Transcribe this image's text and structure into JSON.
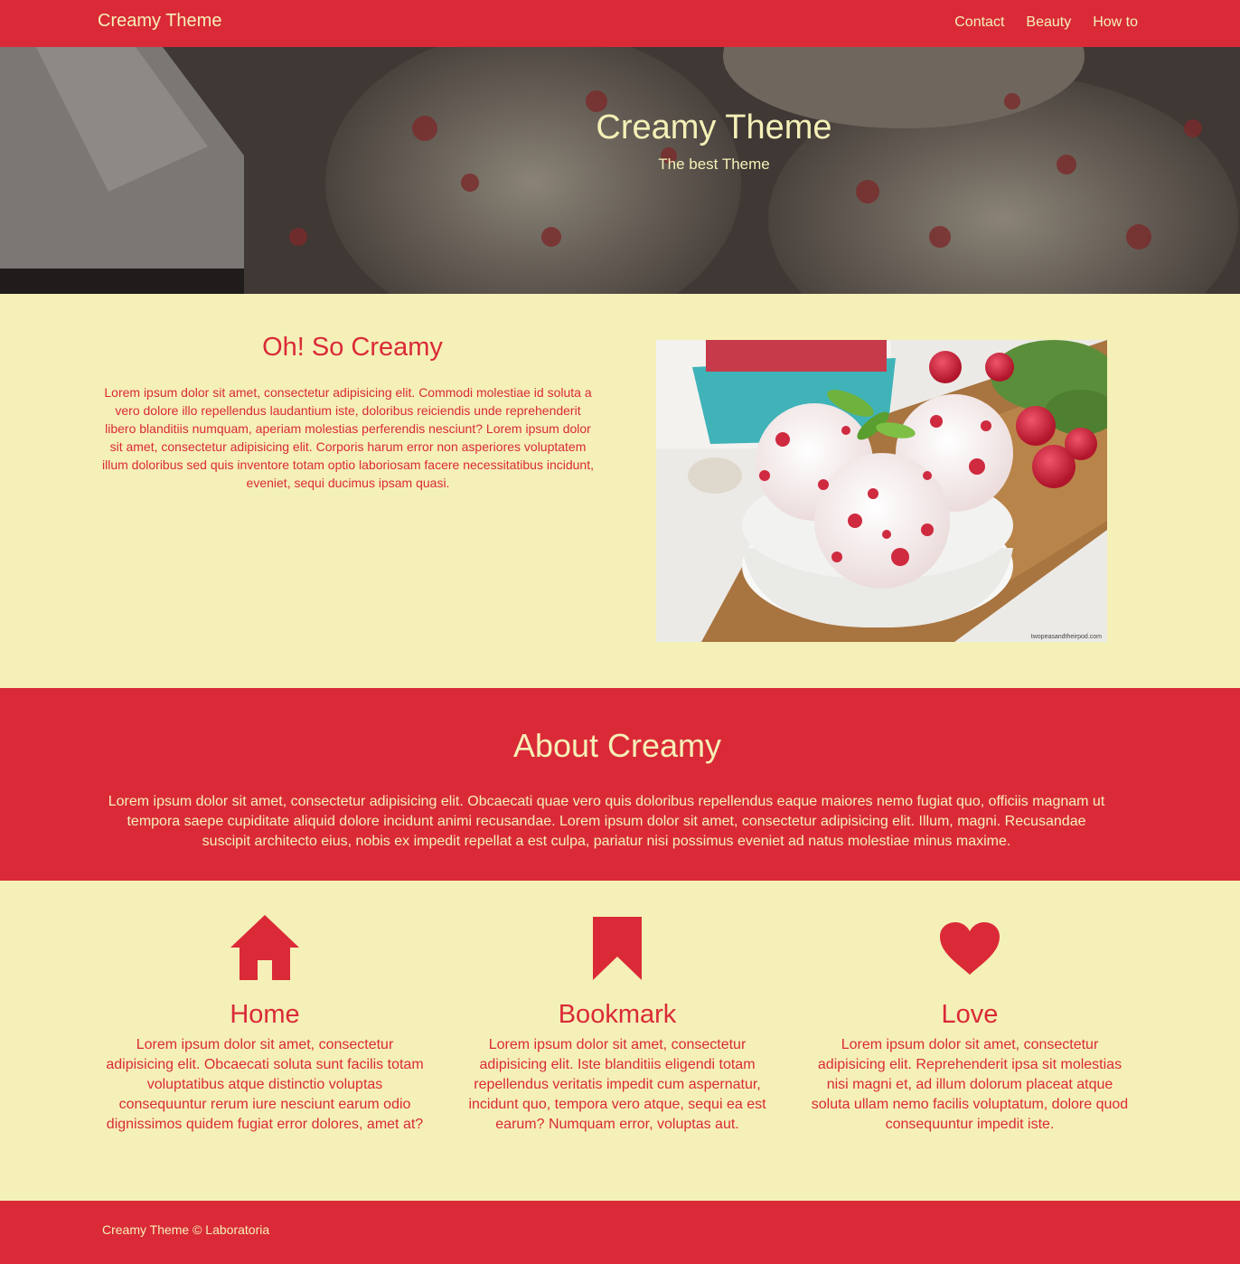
{
  "nav": {
    "brand": "Creamy Theme",
    "links": [
      "Contact",
      "Beauty",
      "How to"
    ]
  },
  "hero": {
    "title": "Creamy Theme",
    "subtitle": "The best Theme"
  },
  "feature": {
    "title": "Oh! So Creamy",
    "text": "Lorem ipsum dolor sit amet, consectetur adipisicing elit. Commodi molestiae id soluta a vero dolore illo repellendus laudantium iste, doloribus reiciendis unde reprehenderit libero blanditiis numquam, aperiam molestias perferendis nesciunt? Lorem ipsum dolor sit amet, consectetur adipisicing elit. Corporis harum error non asperiores voluptatem illum doloribus sed quis inventore totam optio laboriosam facere necessitatibus incidunt, eveniet, sequi ducimus ipsam quasi.",
    "image_credit": "twopeasandtheirpod.com"
  },
  "about": {
    "title": "About Creamy",
    "text": "Lorem ipsum dolor sit amet, consectetur adipisicing elit. Obcaecati quae vero quis doloribus repellendus eaque maiores nemo fugiat quo, officiis magnam ut tempora saepe cupiditate aliquid dolore incidunt animi recusandae. Lorem ipsum dolor sit amet, consectetur adipisicing elit. Illum, magni. Recusandae suscipit architecto eius, nobis ex impedit repellat a est culpa, pariatur nisi possimus eveniet ad natus molestiae minus maxime."
  },
  "services": [
    {
      "icon": "home-icon",
      "title": "Home",
      "text": "Lorem ipsum dolor sit amet, consectetur adipisicing elit. Obcaecati soluta sunt facilis totam voluptatibus atque distinctio voluptas consequuntur rerum iure nesciunt earum odio dignissimos quidem fugiat error dolores, amet at?"
    },
    {
      "icon": "bookmark-icon",
      "title": "Bookmark",
      "text": "Lorem ipsum dolor sit amet, consectetur adipisicing elit. Iste blanditiis eligendi totam repellendus veritatis impedit cum aspernatur, incidunt quo, tempora vero atque, sequi ea est earum? Numquam error, voluptas aut."
    },
    {
      "icon": "heart-icon",
      "title": "Love",
      "text": "Lorem ipsum dolor sit amet, consectetur adipisicing elit. Reprehenderit ipsa sit molestias nisi magni et, ad illum dolorum placeat atque soluta ullam nemo facilis voluptatum, dolore quod consequuntur impedit iste."
    }
  ],
  "footer": {
    "text": "Creamy Theme © Laboratoria"
  },
  "colors": {
    "primary": "#da2a38",
    "cream": "#f5f0b7"
  }
}
